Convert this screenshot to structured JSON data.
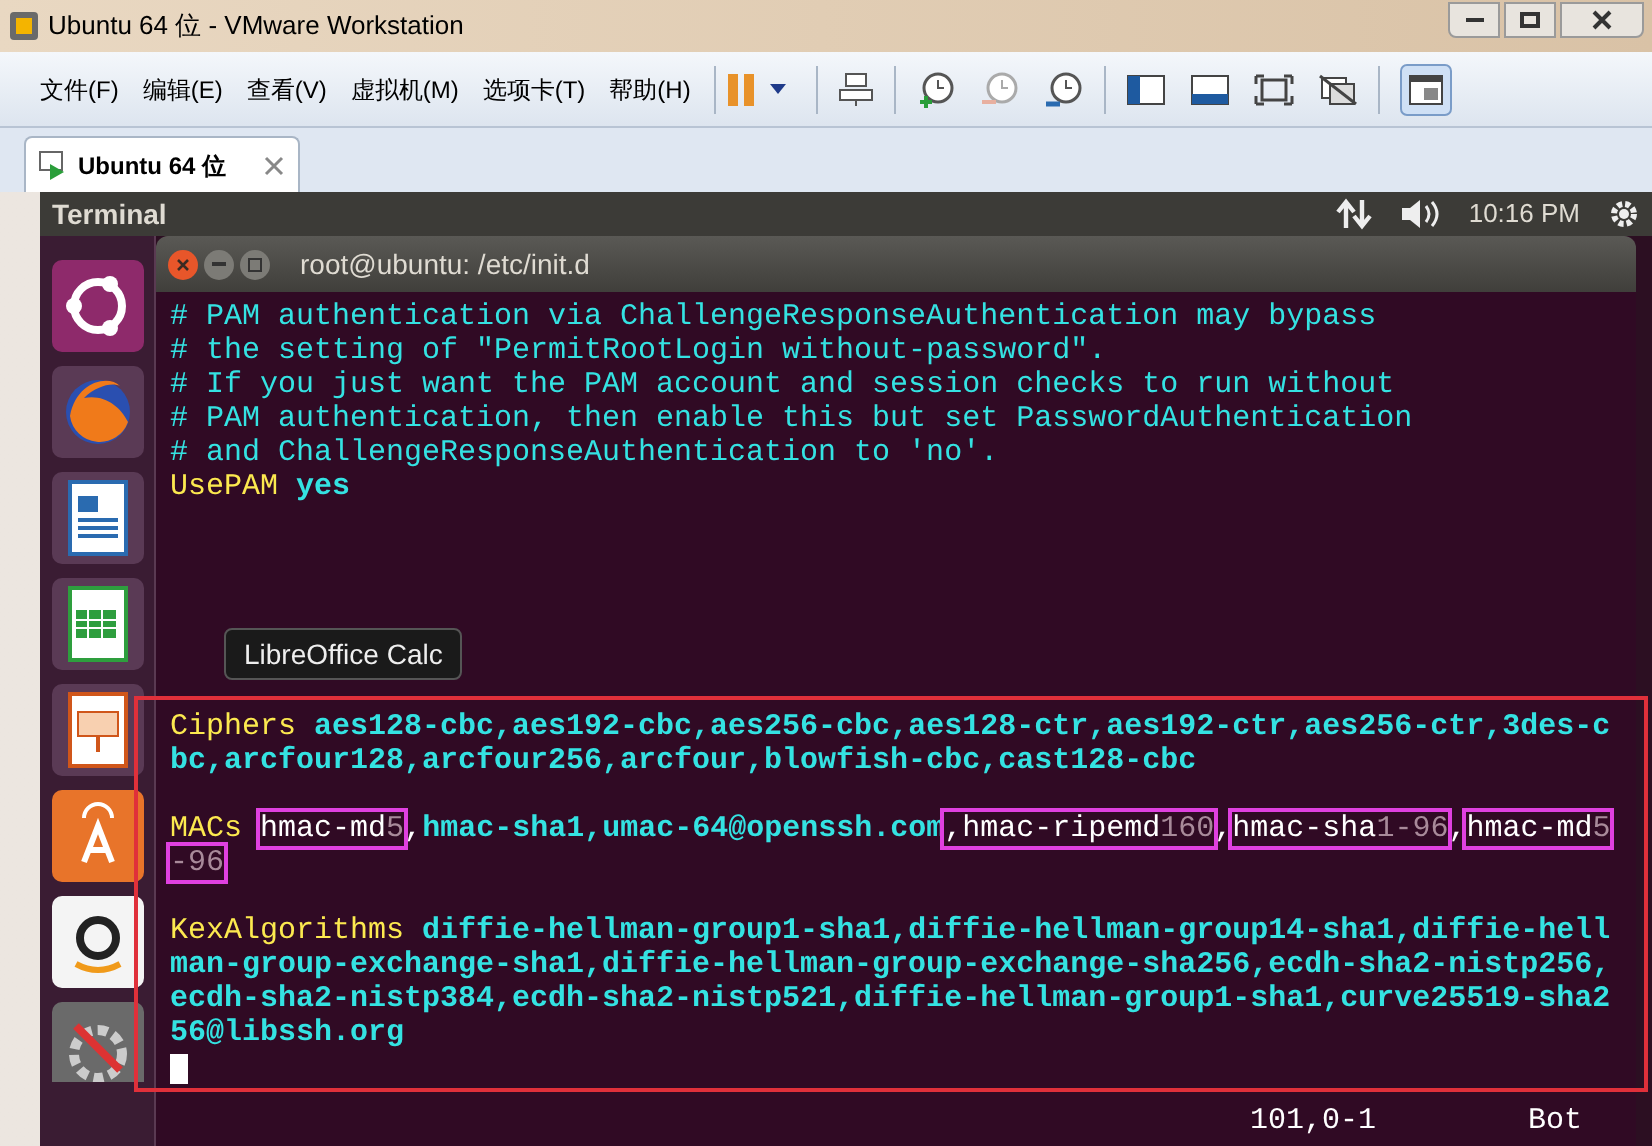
{
  "window": {
    "title": "Ubuntu 64 位 - VMware Workstation"
  },
  "menu": [
    "文件(F)",
    "编辑(E)",
    "查看(V)",
    "虚拟机(M)",
    "选项卡(T)",
    "帮助(H)"
  ],
  "tabs": [
    {
      "label": "Ubuntu 64 位",
      "selected": true
    }
  ],
  "top_bar": {
    "app": "Terminal",
    "time": "10:16 PM"
  },
  "launcher": [
    {
      "kind": "dash"
    },
    {
      "kind": "browser"
    },
    {
      "kind": "writer"
    },
    {
      "kind": "calc"
    },
    {
      "kind": "impress"
    },
    {
      "kind": "store"
    },
    {
      "kind": "amazon"
    },
    {
      "kind": "settings"
    }
  ],
  "tooltip": "LibreOffice Calc",
  "terminal": {
    "title": "root@ubuntu: /etc/init.d",
    "lines": [
      [
        {
          "kind": "comment",
          "text": "# PAM authentication via ChallengeResponseAuthentication may bypass"
        }
      ],
      [
        {
          "kind": "comment",
          "text": "# the setting of \"PermitRootLogin without-password\"."
        }
      ],
      [
        {
          "kind": "comment",
          "text": "# If you just want the PAM account and session checks to run without"
        }
      ],
      [
        {
          "kind": "comment",
          "text": "# PAM authentication, then enable this but set PasswordAuthentication"
        }
      ],
      [
        {
          "kind": "comment",
          "text": "# and ChallengeResponseAuthentication to 'no'."
        }
      ],
      [
        {
          "kind": "keyword",
          "text": "UsePAM "
        },
        {
          "kind": "value",
          "text": "yes"
        }
      ]
    ],
    "highlighted_blocks": [
      [
        [
          {
            "kind": "keyword",
            "text": "Ciphers "
          },
          {
            "kind": "value",
            "text": "aes128-cbc,aes192-cbc,aes256-cbc,aes128-ctr,aes192-ctr,aes256-ctr,3des-c"
          }
        ],
        [
          {
            "kind": "value",
            "text": "bc,arcfour128,arcfour256,arcfour,blowfish-cbc,cast128-cbc"
          }
        ]
      ],
      [
        [
          {
            "kind": "keyword",
            "text": "MACs "
          },
          {
            "kind": "box",
            "parts": [
              {
                "kind": "plain",
                "text": "hmac-md"
              },
              {
                "kind": "dim",
                "text": "5"
              }
            ]
          },
          {
            "kind": "plain",
            "text": ","
          },
          {
            "kind": "value",
            "text": "hmac-sha1,umac-64@openssh.com"
          },
          {
            "kind": "box",
            "parts": [
              {
                "kind": "plain",
                "text": ",hmac-ripemd"
              },
              {
                "kind": "dim",
                "text": "160"
              }
            ]
          },
          {
            "kind": "plain",
            "text": ","
          },
          {
            "kind": "box",
            "parts": [
              {
                "kind": "plain",
                "text": "hmac-sha"
              },
              {
                "kind": "dim",
                "text": "1-96"
              }
            ]
          },
          {
            "kind": "plain",
            "text": ","
          },
          {
            "kind": "box",
            "parts": [
              {
                "kind": "plain",
                "text": "hmac-md"
              },
              {
                "kind": "dim",
                "text": "5"
              }
            ]
          }
        ],
        [
          {
            "kind": "box",
            "parts": [
              {
                "kind": "dim",
                "text": "-96"
              }
            ]
          }
        ]
      ],
      [
        [
          {
            "kind": "keyword",
            "text": "KexAlgorithms "
          },
          {
            "kind": "value",
            "text": "diffie-hellman-group1-sha1,diffie-hellman-group14-sha1,diffie-hell"
          }
        ],
        [
          {
            "kind": "value",
            "text": "man-group-exchange-sha1,diffie-hellman-group-exchange-sha256,ecdh-sha2-nistp256,"
          }
        ],
        [
          {
            "kind": "value",
            "text": "ecdh-sha2-nistp384,ecdh-sha2-nistp521,diffie-hellman-group1-sha1,curve25519-sha2"
          }
        ],
        [
          {
            "kind": "value",
            "text": "56@libssh.org"
          }
        ]
      ]
    ],
    "position": "101,0-1",
    "scroll": "Bot"
  }
}
